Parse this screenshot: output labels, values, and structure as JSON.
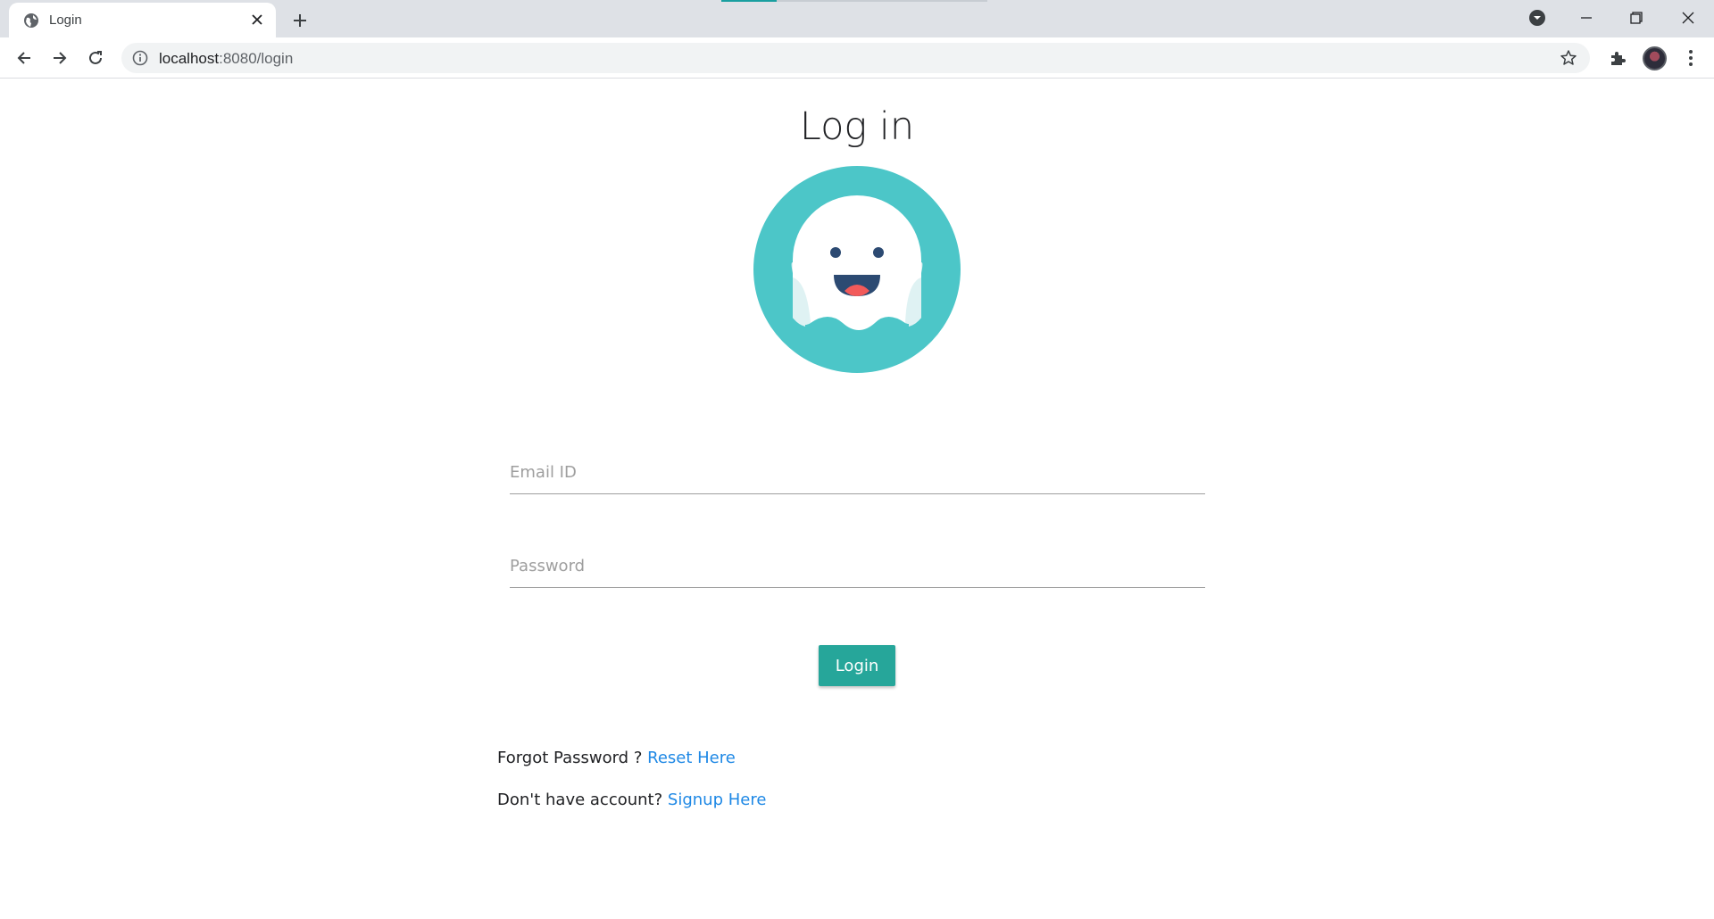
{
  "browser": {
    "tab_title": "Login",
    "url_host": "localhost",
    "url_path": ":8080/login"
  },
  "page": {
    "heading": "Log in",
    "email_placeholder": "Email ID",
    "password_placeholder": "Password",
    "login_label": "Login",
    "forgot_text": "Forgot Password ?",
    "reset_link": "Reset Here",
    "signup_text": "Don't have account?",
    "signup_link": "Signup Here"
  },
  "colors": {
    "logo_bg": "#4cc6c8",
    "button": "#26a69a",
    "link": "#1e88e5"
  }
}
